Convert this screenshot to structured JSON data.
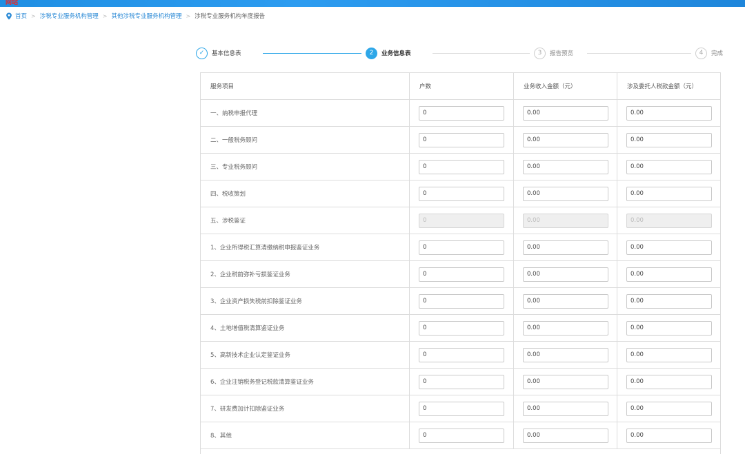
{
  "topbar": {
    "brand": "网站"
  },
  "breadcrumb": [
    {
      "label": "首页",
      "current": false
    },
    {
      "label": "涉税专业服务机构管理",
      "current": false
    },
    {
      "label": "其他涉税专业服务机构管理",
      "current": false
    },
    {
      "label": "涉税专业服务机构年度报告",
      "current": true
    }
  ],
  "breadcrumb_separator": ">",
  "steps": [
    {
      "mark": "✓",
      "label": "基本信息表",
      "state": "done"
    },
    {
      "mark": "2",
      "label": "业务信息表",
      "state": "active"
    },
    {
      "mark": "3",
      "label": "报告预览",
      "state": "todo"
    },
    {
      "mark": "4",
      "label": "完成",
      "state": "todo"
    }
  ],
  "table": {
    "headers": [
      "服务项目",
      "户数",
      "业务收入金额（元）",
      "涉及委托人税款金额（元）"
    ],
    "rows": [
      {
        "item": "一、纳税申报代理",
        "households": "0",
        "income": "0.00",
        "tax": "0.00",
        "disabled": false
      },
      {
        "item": "二、一般税务顾问",
        "households": "0",
        "income": "0.00",
        "tax": "0.00",
        "disabled": false
      },
      {
        "item": "三、专业税务顾问",
        "households": "0",
        "income": "0.00",
        "tax": "0.00",
        "disabled": false
      },
      {
        "item": "四、税收策划",
        "households": "0",
        "income": "0.00",
        "tax": "0.00",
        "disabled": false
      },
      {
        "item": "五、涉税鉴证",
        "households": "0",
        "income": "0.00",
        "tax": "0.00",
        "disabled": true
      },
      {
        "item": "1、企业所得税汇算清缴纳税申报鉴证业务",
        "households": "0",
        "income": "0.00",
        "tax": "0.00",
        "disabled": false
      },
      {
        "item": "2、企业税前弥补亏损鉴证业务",
        "households": "0",
        "income": "0.00",
        "tax": "0.00",
        "disabled": false
      },
      {
        "item": "3、企业资产损失税前扣除鉴证业务",
        "households": "0",
        "income": "0.00",
        "tax": "0.00",
        "disabled": false
      },
      {
        "item": "4、土地增值税清算鉴证业务",
        "households": "0",
        "income": "0.00",
        "tax": "0.00",
        "disabled": false
      },
      {
        "item": "5、高新技术企业认定鉴证业务",
        "households": "0",
        "income": "0.00",
        "tax": "0.00",
        "disabled": false
      },
      {
        "item": "6、企业注销税务登记税款清算鉴证业务",
        "households": "0",
        "income": "0.00",
        "tax": "0.00",
        "disabled": false
      },
      {
        "item": "7、研发费加计扣除鉴证业务",
        "households": "0",
        "income": "0.00",
        "tax": "0.00",
        "disabled": false
      },
      {
        "item": "8、其他",
        "households": "0",
        "income": "0.00",
        "tax": "0.00",
        "disabled": false
      }
    ]
  },
  "colors": {
    "accent": "#2ea7e8",
    "link": "#2b8ad6",
    "topbar": "#1f8fe3",
    "border": "#dcdcdc"
  },
  "icons": {
    "breadcrumb": "location-pin-icon",
    "done_step": "check-icon"
  }
}
